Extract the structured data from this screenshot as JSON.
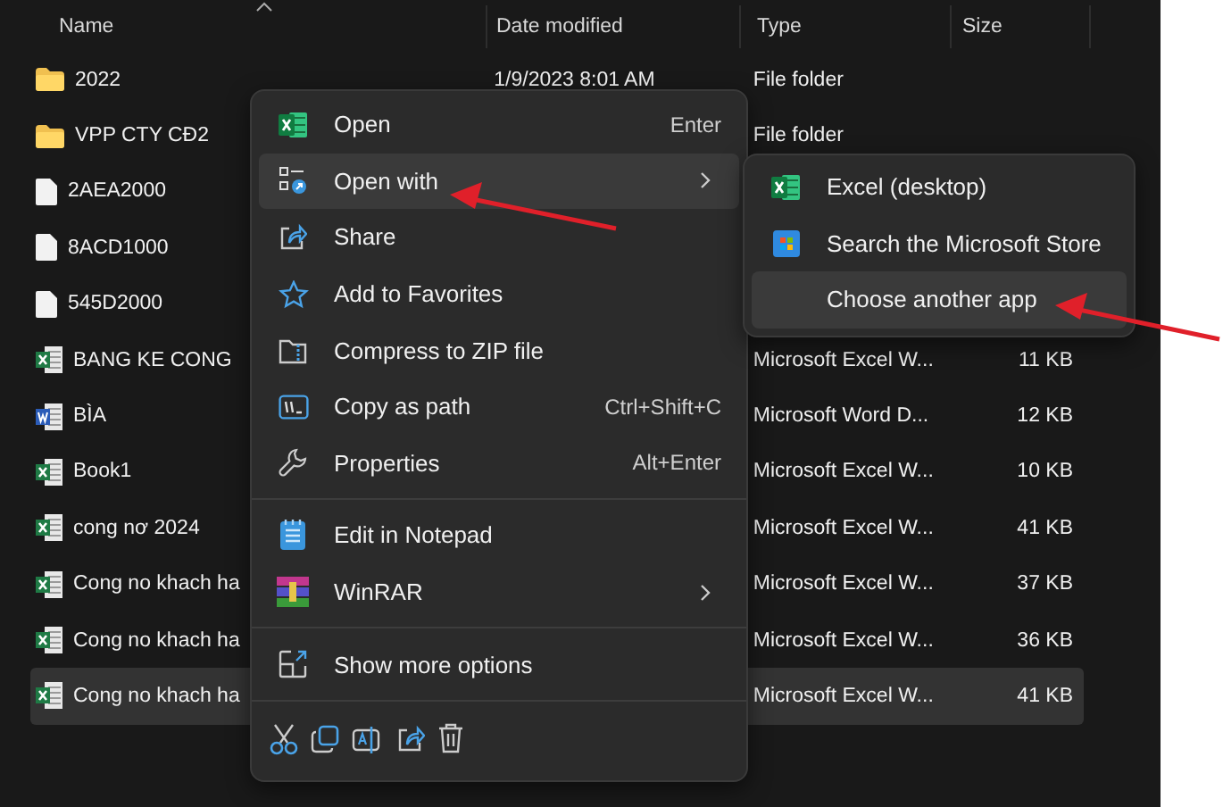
{
  "columns": [
    {
      "label": "Name"
    },
    {
      "label": "Date modified"
    },
    {
      "label": "Type"
    },
    {
      "label": "Size"
    }
  ],
  "rows": [
    {
      "kind": "folder",
      "name": "2022",
      "date": "1/9/2023 8:01 AM",
      "type": "File folder",
      "selected": false
    },
    {
      "kind": "folder",
      "name": "VPP CTY CĐ2",
      "type": "File folder",
      "selected": false
    },
    {
      "kind": "file",
      "name": "2AEA2000",
      "selected": false
    },
    {
      "kind": "file",
      "name": "8ACD1000",
      "selected": false
    },
    {
      "kind": "file",
      "name": "545D2000",
      "selected": false
    },
    {
      "kind": "excel",
      "name": "BANG KE CONG",
      "type": "Microsoft Excel W...",
      "size": "11 KB",
      "selected": false
    },
    {
      "kind": "word",
      "name": "BÌA",
      "type": "Microsoft Word D...",
      "size": "12 KB",
      "selected": false
    },
    {
      "kind": "excel",
      "name": "Book1",
      "type": "Microsoft Excel W...",
      "size": "10 KB",
      "selected": false
    },
    {
      "kind": "excel",
      "name": "cong nơ 2024",
      "type": "Microsoft Excel W...",
      "size": "41 KB",
      "selected": false
    },
    {
      "kind": "excel",
      "name": "Cong no khach ha",
      "type": "Microsoft Excel W...",
      "size": "37 KB",
      "selected": false
    },
    {
      "kind": "excel",
      "name": "Cong no khach ha",
      "type": "Microsoft Excel W...",
      "size": "36 KB",
      "selected": false
    },
    {
      "kind": "excel",
      "name": "Cong no khach ha",
      "type": "Microsoft Excel W...",
      "size": "41 KB",
      "selected": true
    }
  ],
  "context_menu": {
    "groups": [
      [
        {
          "label": "Open",
          "shortcut": "Enter",
          "submenu": false,
          "selected": false
        },
        {
          "label": "Open with",
          "submenu": true,
          "selected": true
        },
        {
          "label": "Share",
          "submenu": false,
          "selected": false
        },
        {
          "label": "Add to Favorites",
          "submenu": false,
          "selected": false
        },
        {
          "label": "Compress to ZIP file",
          "submenu": false,
          "selected": false
        },
        {
          "label": "Copy as path",
          "shortcut": "Ctrl+Shift+C",
          "submenu": false,
          "selected": false
        },
        {
          "label": "Properties",
          "shortcut": "Alt+Enter",
          "submenu": false,
          "selected": false
        }
      ],
      [
        {
          "label": "Edit in Notepad",
          "submenu": false,
          "selected": false
        },
        {
          "label": "WinRAR",
          "submenu": true,
          "selected": false
        }
      ],
      [
        {
          "label": "Show more options",
          "submenu": false,
          "selected": false
        }
      ]
    ]
  },
  "submenu": {
    "items": [
      {
        "label": "Excel (desktop)",
        "selected": false
      },
      {
        "label": "Search the Microsoft Store",
        "selected": false
      },
      {
        "label": "Choose another app",
        "selected": true
      }
    ]
  }
}
